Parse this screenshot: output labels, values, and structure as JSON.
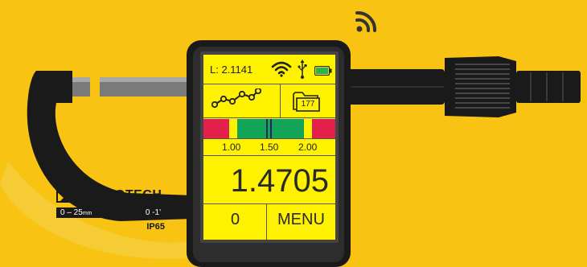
{
  "device": {
    "brand": "MICROTECH",
    "range_metric": "0 – 25",
    "range_metric_unit": "mm",
    "range_imperial": "0 -1'",
    "ip_rating": "IP65"
  },
  "screen": {
    "length_readout": "L: 2.1141",
    "folder_count": "177",
    "tolerance_ticks": [
      "1.00",
      "1.50",
      "2.00"
    ],
    "measurement": "1.4705",
    "left_softkey": "0",
    "right_softkey": "MENU"
  },
  "icons": [
    "wireless-signal-icon",
    "wifi-icon",
    "usb-icon",
    "battery-icon",
    "trend-chart-icon",
    "folder-icon",
    "microtech-logo-icon"
  ],
  "colors": {
    "background": "#F8C313",
    "screen": "#FFF200",
    "tolerance_red": "#E3204B",
    "tolerance_green": "#14A457",
    "battery_green": "#2DB34A",
    "body": "#1A1A1A"
  }
}
